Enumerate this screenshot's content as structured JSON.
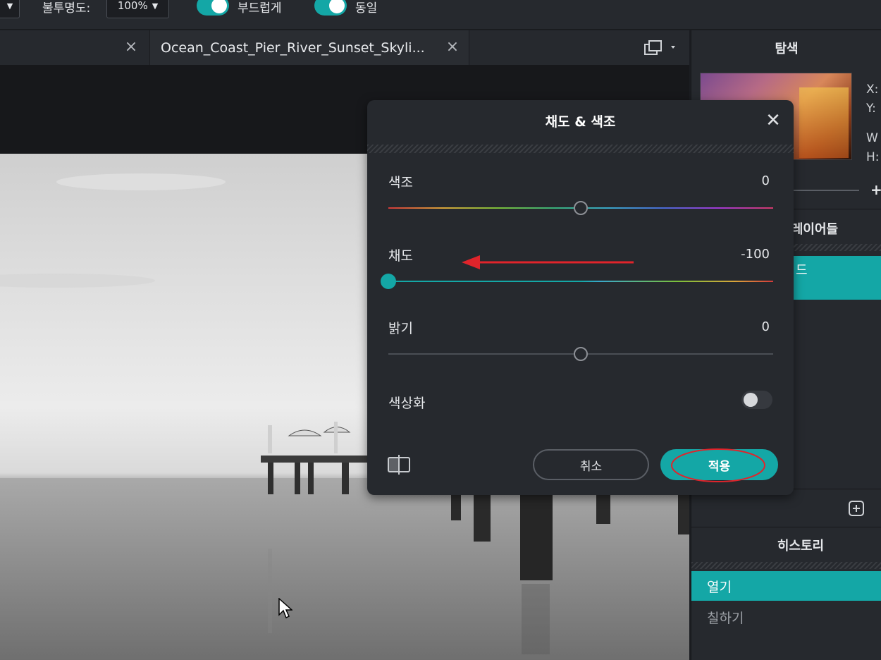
{
  "toolbar": {
    "opacity_label": "불투명도:",
    "opacity_value": "100%",
    "smooth_label": "부드럽게",
    "same_label": "동일",
    "accent": "#14a7a6"
  },
  "tabs": [
    {
      "label": ""
    },
    {
      "label": "Ocean_Coast_Pier_River_Sunset_Skyli..."
    }
  ],
  "right_panel": {
    "navigator_title": "탐색",
    "coords": {
      "x": "X:",
      "y": "Y:",
      "w": "W",
      "h": "H:"
    },
    "zoom_plus": "+",
    "layers_title": "레이어들",
    "layer_active_label": "드",
    "history_title": "히스토리",
    "history_items": [
      "열기",
      "칠하기"
    ]
  },
  "dialog": {
    "title": "채도 & 색조",
    "hue_label": "색조",
    "hue_value": "0",
    "saturation_label": "채도",
    "saturation_value": "-100",
    "brightness_label": "밝기",
    "brightness_value": "0",
    "colorize_label": "색상화",
    "colorize_on": false,
    "cancel_label": "취소",
    "apply_label": "적용",
    "hue_position": 0.5,
    "saturation_position": 0.0,
    "brightness_position": 0.5
  }
}
